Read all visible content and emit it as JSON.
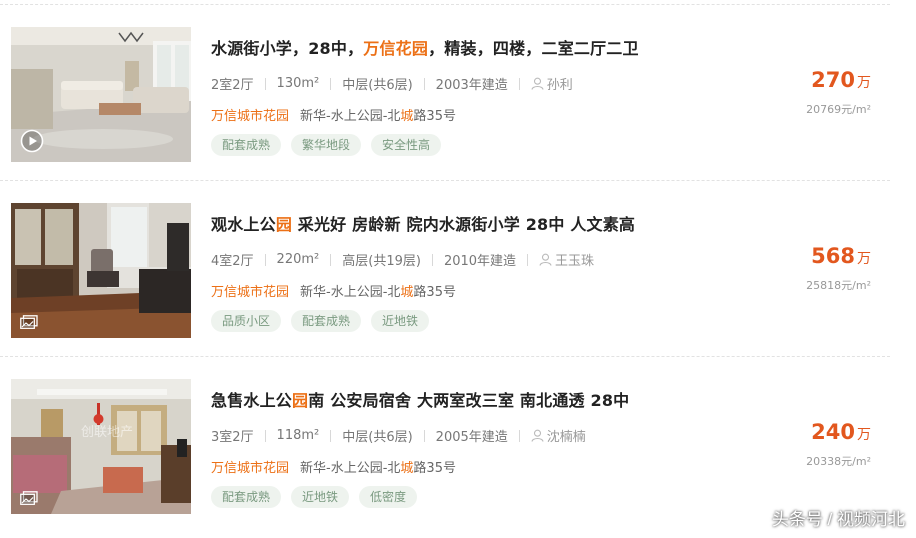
{
  "listings": [
    {
      "title_parts": [
        {
          "text": "水源街小学，28中，",
          "hl": false
        },
        {
          "text": "万信花园",
          "hl": true
        },
        {
          "text": "，精装，四楼，二室二厅二卫",
          "hl": false
        }
      ],
      "layout": "2室2厅",
      "area": "130m²",
      "floor": "中层(共6层)",
      "year": "2003年建造",
      "agent": "孙利",
      "community": "万信城市花园",
      "address_parts": [
        {
          "text": "新华-水上公园-北",
          "hl": false
        },
        {
          "text": "城",
          "hl": true
        },
        {
          "text": "路35号",
          "hl": false
        }
      ],
      "tags": [
        "配套成熟",
        "繁华地段",
        "安全性高"
      ],
      "price": "270",
      "price_unit": "万",
      "unit_price": "20769元/m²",
      "badge_icon": "play-icon"
    },
    {
      "title_parts": [
        {
          "text": "观水上公",
          "hl": false
        },
        {
          "text": "园",
          "hl": true
        },
        {
          "text": " 采光好 房龄新 院内水源街小学 28中 人文素高",
          "hl": false
        }
      ],
      "layout": "4室2厅",
      "area": "220m²",
      "floor": "高层(共19层)",
      "year": "2010年建造",
      "agent": "王玉珠",
      "community": "万信城市花园",
      "address_parts": [
        {
          "text": "新华-水上公园-北",
          "hl": false
        },
        {
          "text": "城",
          "hl": true
        },
        {
          "text": "路35号",
          "hl": false
        }
      ],
      "tags": [
        "品质小区",
        "配套成熟",
        "近地铁"
      ],
      "price": "568",
      "price_unit": "万",
      "unit_price": "25818元/m²",
      "badge_icon": "gallery-icon"
    },
    {
      "title_parts": [
        {
          "text": "急售水上公",
          "hl": false
        },
        {
          "text": "园",
          "hl": true
        },
        {
          "text": "南 公安局宿舍 大两室改三室 南北通透 28中",
          "hl": false
        }
      ],
      "layout": "3室2厅",
      "area": "118m²",
      "floor": "中层(共6层)",
      "year": "2005年建造",
      "agent": "沈楠楠",
      "community": "万信城市花园",
      "address_parts": [
        {
          "text": "新华-水上公园-北",
          "hl": false
        },
        {
          "text": "城",
          "hl": true
        },
        {
          "text": "路35号",
          "hl": false
        }
      ],
      "tags": [
        "配套成熟",
        "近地铁",
        "低密度"
      ],
      "price": "240",
      "price_unit": "万",
      "unit_price": "20338元/m²",
      "badge_icon": "gallery-icon"
    }
  ],
  "watermark": "头条号 / 视频河北",
  "colors": {
    "accent": "#ec7016",
    "price": "#e2571e",
    "tag_bg": "#eef3ee",
    "tag_text": "#7a9a80"
  }
}
